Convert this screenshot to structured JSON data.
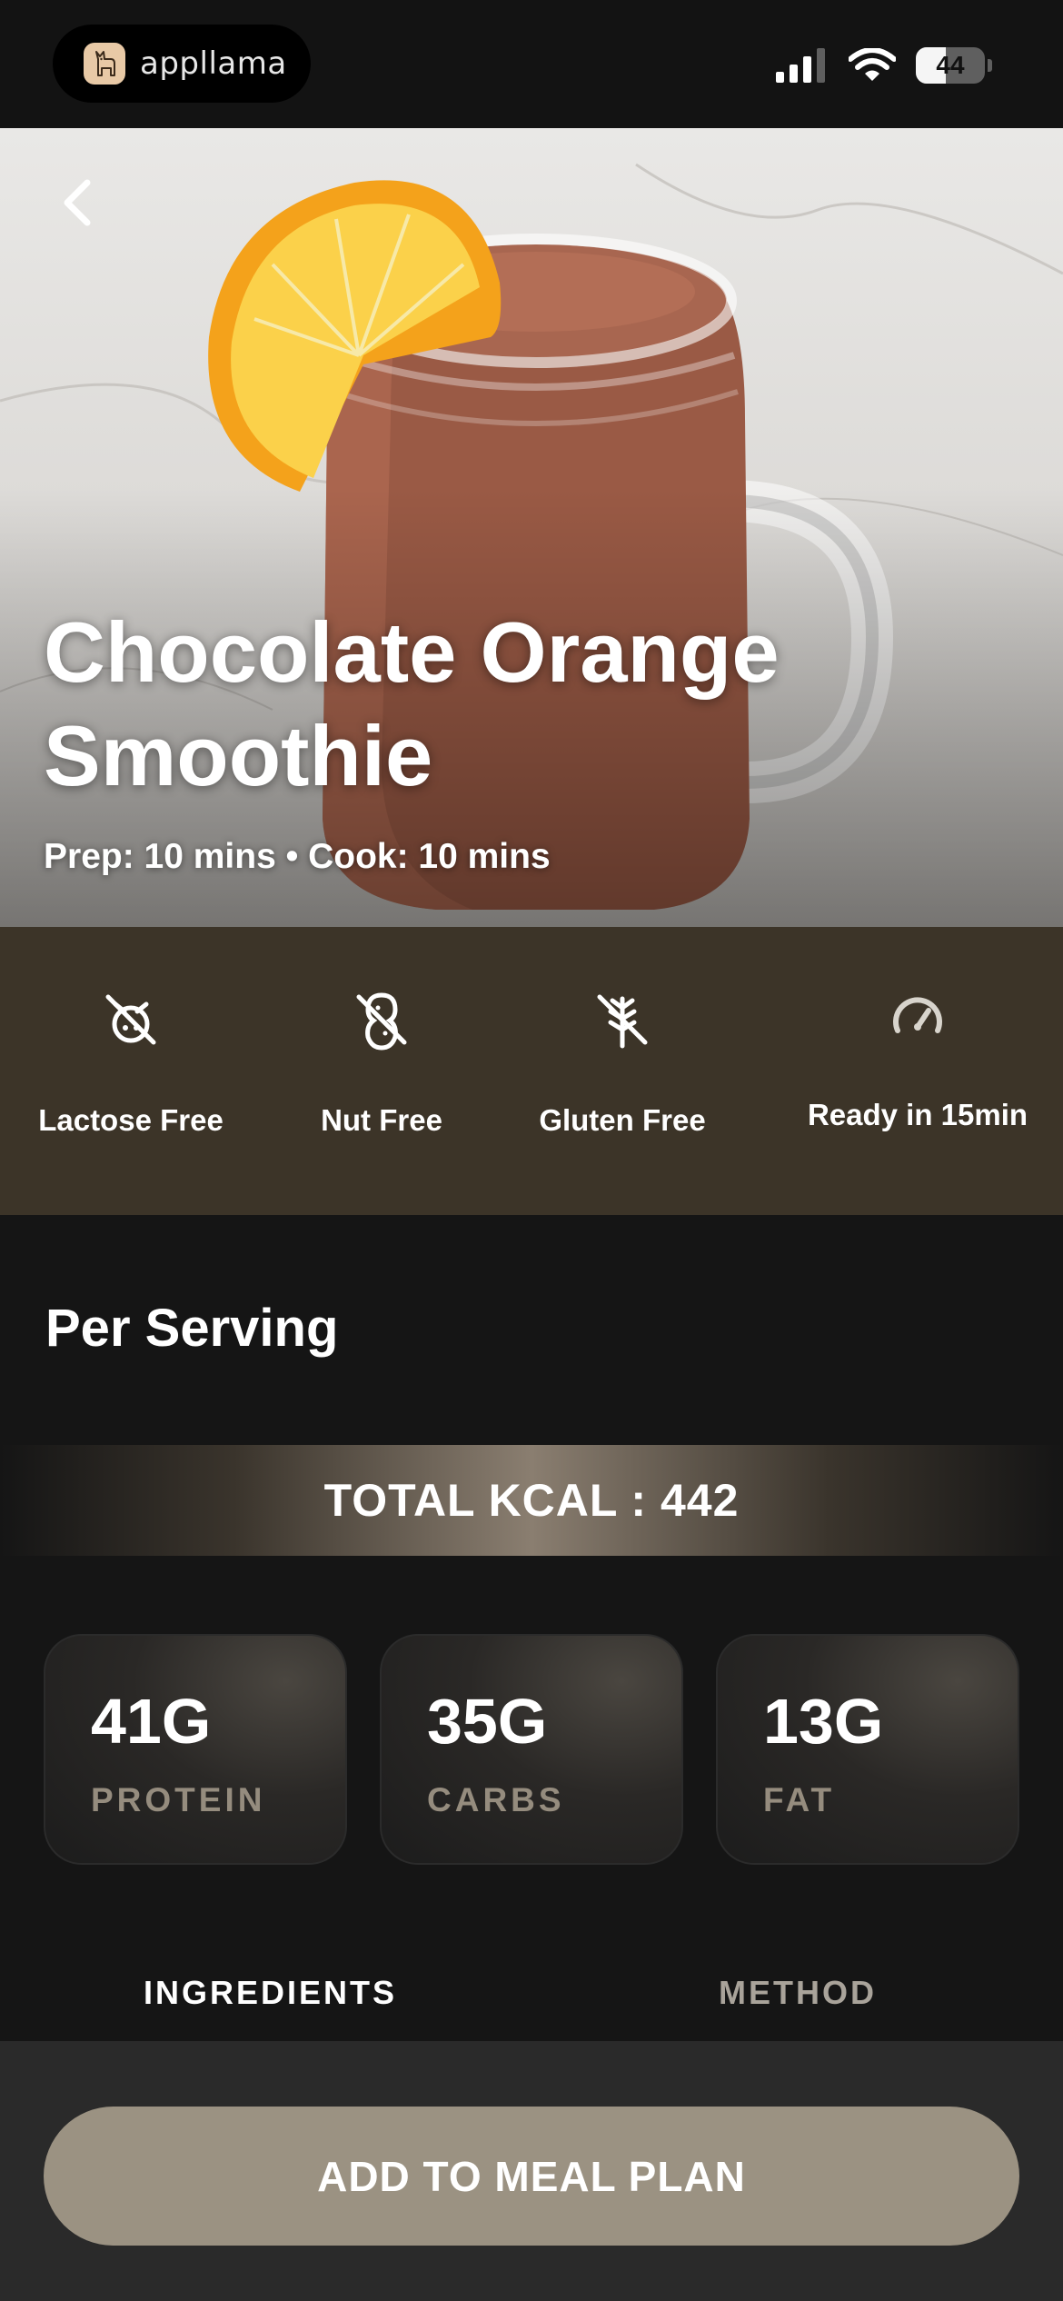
{
  "status_bar": {
    "app_name": "appllama",
    "battery_level": "44",
    "battery_percent": 44
  },
  "hero": {
    "title": "Chocolate Orange Smoothie",
    "times": "Prep: 10 mins • Cook: 10 mins"
  },
  "tags": [
    {
      "label": "Lactose Free",
      "icon": "no-milk-icon"
    },
    {
      "label": "Nut Free",
      "icon": "no-nut-icon"
    },
    {
      "label": "Gluten Free",
      "icon": "no-wheat-icon"
    },
    {
      "label": "Ready in 15min",
      "icon": "speedometer-icon"
    }
  ],
  "nutrition": {
    "heading": "Per Serving",
    "total_kcal": "TOTAL KCAL : 442",
    "macros": [
      {
        "value": "41G",
        "label": "PROTEIN"
      },
      {
        "value": "35G",
        "label": "CARBS"
      },
      {
        "value": "13G",
        "label": "FAT"
      }
    ]
  },
  "tabs": [
    {
      "label": "INGREDIENTS",
      "active": true
    },
    {
      "label": "METHOD",
      "active": false
    }
  ],
  "cta": {
    "label": "ADD TO MEAL PLAN"
  },
  "colors": {
    "tag_band": "#3c3428",
    "cta": "#9b9282",
    "macro_label": "#958c7e"
  }
}
